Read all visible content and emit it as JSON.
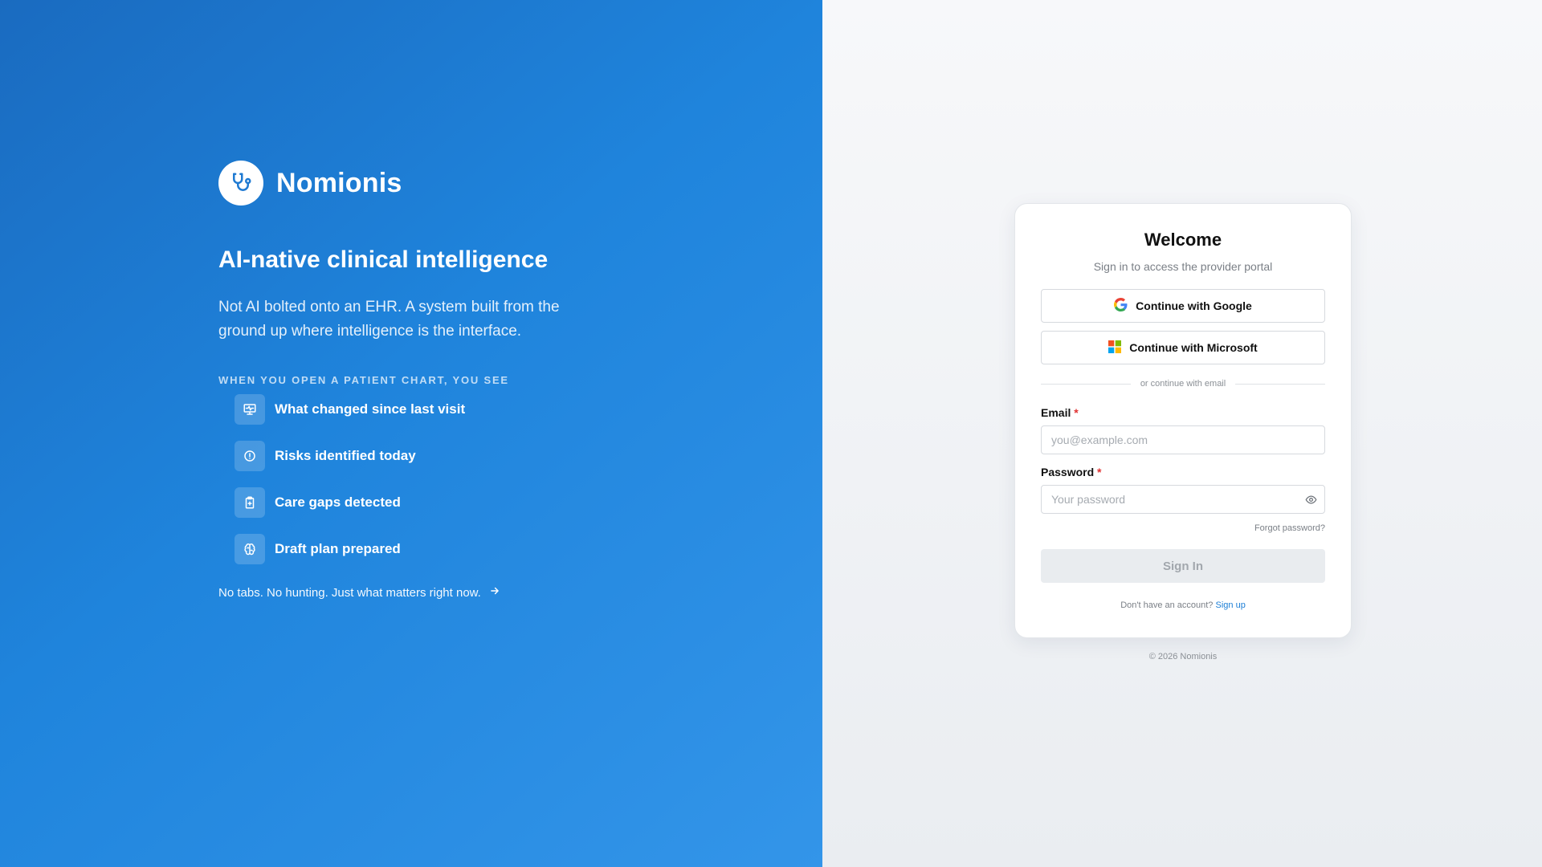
{
  "brand": {
    "name": "Nomionis",
    "logo_icon": "stethoscope-icon",
    "accent": "#1f84dc"
  },
  "hero": {
    "headline": "AI-native clinical intelligence",
    "lede": "Not AI bolted onto an EHR. A system built from the ground up where intelligence is the interface.",
    "section_label": "WHEN YOU OPEN A PATIENT CHART, YOU SEE",
    "features": [
      {
        "label": "What changed since last visit",
        "icon": "monitor-pulse-icon"
      },
      {
        "label": "Risks identified today",
        "icon": "alert-circle-icon"
      },
      {
        "label": "Care gaps detected",
        "icon": "clipboard-plus-icon"
      },
      {
        "label": "Draft plan prepared",
        "icon": "brain-icon"
      }
    ],
    "tagline": "No tabs. No hunting. Just what matters right now.",
    "tagline_icon": "arrow-right-icon"
  },
  "login": {
    "title": "Welcome",
    "subtitle": "Sign in to access the provider portal",
    "google_label": "Continue with Google",
    "microsoft_label": "Continue with Microsoft",
    "divider_text": "or continue with email",
    "email_label": "Email",
    "email_placeholder": "you@example.com",
    "email_value": "",
    "password_label": "Password",
    "password_placeholder": "Your password",
    "password_value": "",
    "required_mark": "*",
    "forgot_label": "Forgot password?",
    "signin_label": "Sign In",
    "signup_prompt": "Don't have an account?",
    "signup_link": "Sign up"
  },
  "footer": {
    "copyright": "© 2026 Nomionis"
  }
}
